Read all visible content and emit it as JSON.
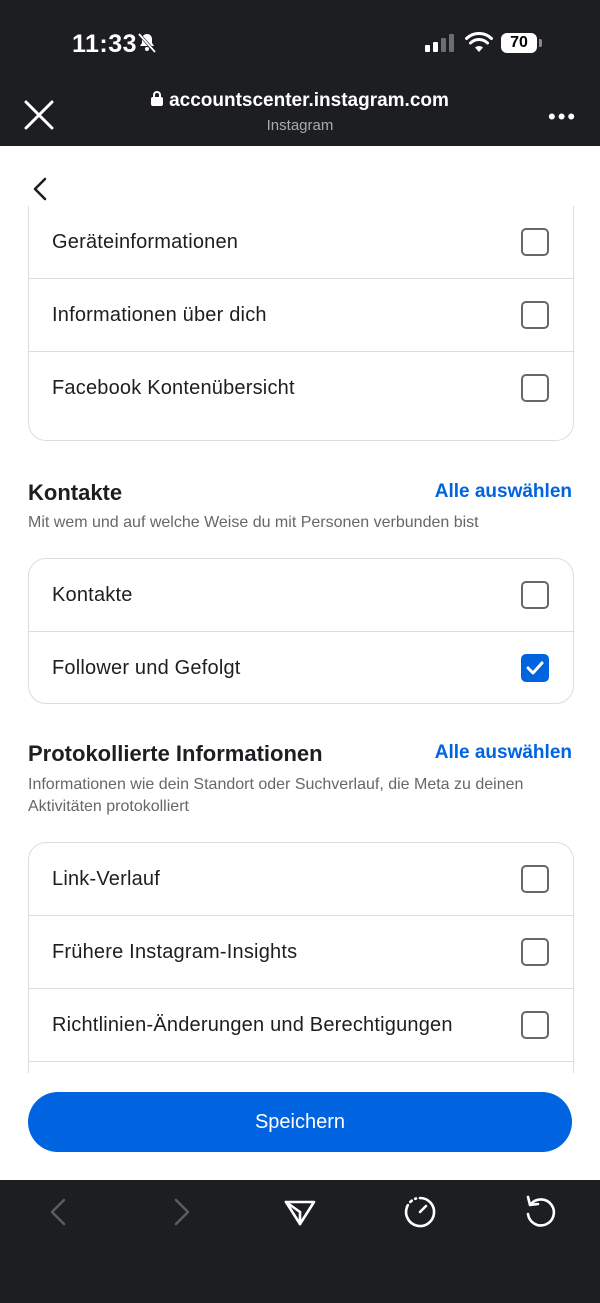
{
  "status": {
    "time": "11:33",
    "battery": "70"
  },
  "browser": {
    "url": "accountscenter.instagram.com",
    "site": "Instagram",
    "more": "•••"
  },
  "group1": {
    "items": [
      {
        "label": "Geräteinformationen",
        "checked": false
      },
      {
        "label": "Informationen über dich",
        "checked": false
      },
      {
        "label": "Facebook Kontenübersicht",
        "checked": false
      }
    ]
  },
  "contacts": {
    "title": "Kontakte",
    "select_all": "Alle auswählen",
    "description": "Mit wem und auf welche Weise du mit Personen verbunden bist",
    "items": [
      {
        "label": "Kontakte",
        "checked": false
      },
      {
        "label": "Follower und Gefolgt",
        "checked": true
      }
    ]
  },
  "logged": {
    "title": "Protokollierte Informationen",
    "select_all": "Alle auswählen",
    "description": "Informationen wie dein Standort oder Suchverlauf, die Meta zu deinen Aktivitäten protokolliert",
    "items": [
      {
        "label": "Link-Verlauf",
        "checked": false
      },
      {
        "label": "Frühere Instagram-Insights",
        "checked": false
      },
      {
        "label": "Richtlinien-Änderungen und Berechtigungen",
        "checked": false
      }
    ]
  },
  "save_label": "Speichern",
  "colors": {
    "accent": "#0064e0",
    "dark": "#1c1e21"
  }
}
